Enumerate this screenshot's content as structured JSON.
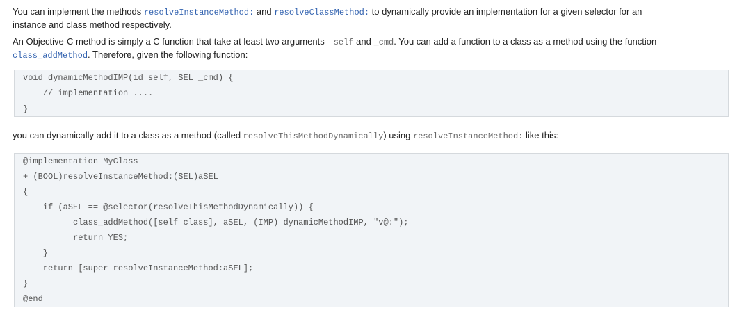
{
  "para1": {
    "t1": "You can implement the methods ",
    "c1": "resolveInstanceMethod:",
    "t2": " and ",
    "c2": "resolveClassMethod:",
    "t3": " to dynamically provide an implementation for a given selector for an",
    "t4": "instance and class method respectively."
  },
  "para2": {
    "t1": "An Objective-C method is simply a C function that take at least two arguments—",
    "c1": "self",
    "t2": " and ",
    "c2": "_cmd",
    "t3": ". You can add a function to a class as a method using the function",
    "c3": "class_addMethod",
    "t4": ". Therefore, given the following function:"
  },
  "code1": [
    "void dynamicMethodIMP(id self, SEL _cmd) {",
    "    // implementation ....",
    "}"
  ],
  "para3": {
    "t1": "you can dynamically add it to a class as a method (called ",
    "c1": "resolveThisMethodDynamically",
    "t2": ") using ",
    "c2": "resolveInstanceMethod:",
    "t3": " like this:"
  },
  "code2": [
    "@implementation MyClass",
    "+ (BOOL)resolveInstanceMethod:(SEL)aSEL",
    "{",
    "    if (aSEL == @selector(resolveThisMethodDynamically)) {",
    "          class_addMethod([self class], aSEL, (IMP) dynamicMethodIMP, \"v@:\");",
    "          return YES;",
    "    }",
    "    return [super resolveInstanceMethod:aSEL];",
    "}",
    "@end"
  ]
}
